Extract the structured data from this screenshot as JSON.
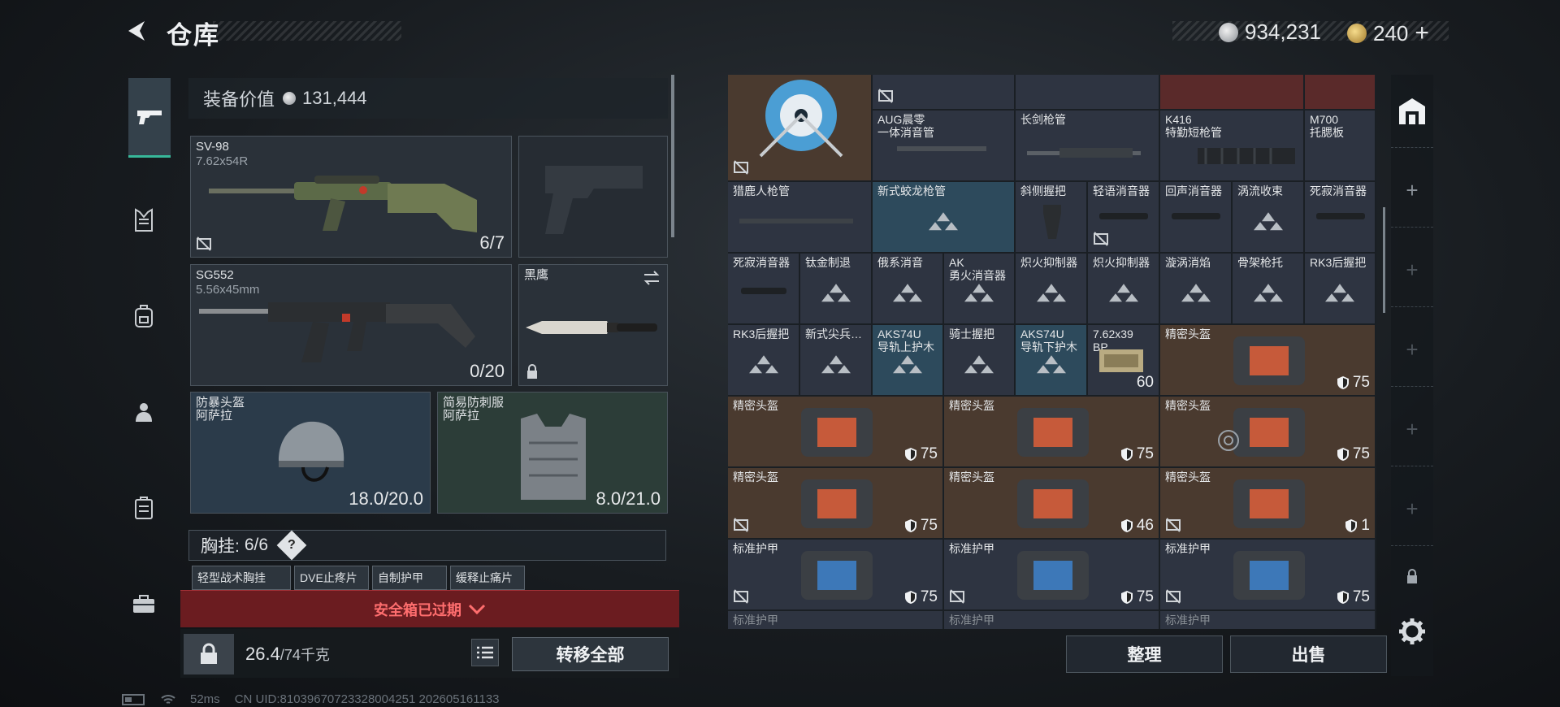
{
  "header": {
    "title": "仓库",
    "currency1": "934,231",
    "currency2": "240",
    "currency2_plus": "+"
  },
  "loadout": {
    "value_label": "装备价值",
    "value": "131,444",
    "primary": {
      "name": "SV-98",
      "caliber": "7.62x54R",
      "count": "6/7"
    },
    "secondary": {
      "name": "SG552",
      "caliber": "5.56x45mm",
      "count": "0/20"
    },
    "melee": {
      "name": "黑鹰"
    },
    "helmet": {
      "name": "防暴头盔",
      "tier": "阿萨拉",
      "durability": "18.0/20.0"
    },
    "armor": {
      "name": "简易防刺服",
      "tier": "阿萨拉",
      "durability": "8.0/21.0"
    },
    "vest_label": "胸挂:",
    "vest_value": "6/6",
    "vest_help": "?",
    "vest_items": [
      "轻型战术胸挂",
      "DVE止疼片",
      "自制护甲",
      "缓释止痛片"
    ],
    "safe_box_status": "安全箱已过期",
    "weight": "26.4",
    "weight_max": "/74千克",
    "transfer_label": "转移全部"
  },
  "warehouse": {
    "row0": [
      {
        "name": "AUG晨零\n一体消音管"
      },
      {
        "name": "长剑枪管"
      },
      {
        "name": "K416\n特勤短枪管"
      },
      {
        "name": "M700\n托腮板"
      }
    ],
    "row1": [
      "猎鹿人枪管",
      "新式蛟龙枪管",
      "斜侧握把",
      "轻语消音器",
      "回声消音器",
      "涡流收束",
      "死寂消音器"
    ],
    "row2": [
      "死寂消音器",
      "钛金制退",
      "俄系消音",
      "AK\n勇火消音器",
      "炽火抑制器",
      "炽火抑制器",
      "漩涡消焰",
      "骨架枪托",
      "RK3后握把"
    ],
    "row3": [
      "RK3后握把",
      "新式尖兵…",
      "AKS74U\n导轨上护木",
      "骑士握把",
      "AKS74U\n导轨下护木",
      "7.62x39\nBP",
      "精密头盔"
    ],
    "ammo_count": "60",
    "helmet_big_val": "75",
    "row4": [
      {
        "name": "精密头盔",
        "val": "75"
      },
      {
        "name": "精密头盔",
        "val": "75"
      },
      {
        "name": "精密头盔",
        "val": "75"
      }
    ],
    "row5": [
      {
        "name": "精密头盔",
        "val": "75"
      },
      {
        "name": "精密头盔",
        "val": "46"
      },
      {
        "name": "精密头盔",
        "val": "1"
      }
    ],
    "row6": [
      {
        "name": "标准护甲",
        "val": "75"
      },
      {
        "name": "标准护甲",
        "val": "75"
      },
      {
        "name": "标准护甲",
        "val": "75"
      }
    ],
    "row7": [
      "标准护甲",
      "标准护甲",
      "标准护甲"
    ]
  },
  "actions": {
    "sort_label": "整理",
    "sell_label": "出售"
  },
  "status": {
    "ping": "52ms",
    "uid": "CN UID:810396707233280042​51 202605161133"
  },
  "colors": {
    "accent": "#37b89a",
    "danger": "#ff6e6e"
  }
}
